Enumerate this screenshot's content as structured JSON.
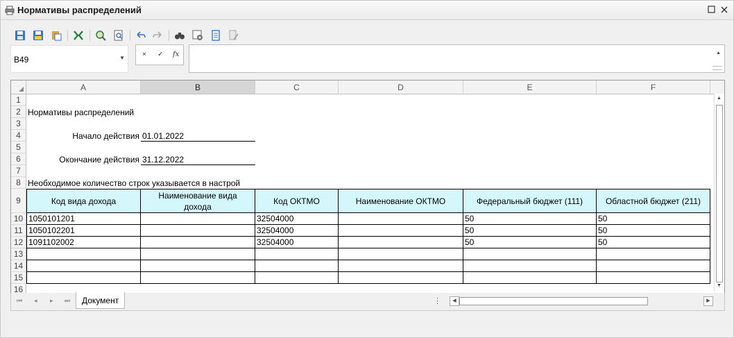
{
  "window": {
    "title": "Нормативы распределений",
    "icon": "printer-icon"
  },
  "toolbar": {
    "icons": [
      "save-icon",
      "save-as-icon",
      "paste-icon",
      "excel-export-icon",
      "find-icon",
      "preview-icon",
      "undo-icon",
      "redo-icon",
      "binoculars-icon",
      "settings-icon",
      "report-icon",
      "edit-icon"
    ]
  },
  "namebox": {
    "value": "B49"
  },
  "formula_bar": {
    "cancel": "×",
    "confirm": "✓",
    "fx": "fx",
    "value": ""
  },
  "sheet": {
    "columns": [
      "A",
      "B",
      "C",
      "D",
      "E",
      "F"
    ],
    "selected_column": "B",
    "row_numbers": [
      "1",
      "2",
      "3",
      "4",
      "5",
      "6",
      "7",
      "8",
      "9",
      "10",
      "11",
      "12",
      "13",
      "14",
      "15",
      "16"
    ],
    "report_title": "Нормативы распределений",
    "start_label": "Начало действия",
    "start_value": "01.01.2022",
    "end_label": "Окончание действия",
    "end_value": "31.12.2022",
    "note": "Необходимое количество строк указывается в настрой",
    "headers": [
      "Код вида дохода",
      "Наименование вида дохода",
      "Код ОКТМО",
      "Наименование ОКТМО",
      "Федеральный бюджет (111)",
      "Областной бюджет (211)"
    ],
    "rows": [
      [
        "1050101201",
        "",
        "32504000",
        "",
        "50",
        "50"
      ],
      [
        "1050102201",
        "",
        "32504000",
        "",
        "50",
        "50"
      ],
      [
        "1091102002",
        "",
        "32504000",
        "",
        "50",
        "50"
      ],
      [
        "",
        "",
        "",
        "",
        "",
        ""
      ],
      [
        "",
        "",
        "",
        "",
        "",
        ""
      ],
      [
        "",
        "",
        "",
        "",
        "",
        ""
      ]
    ]
  },
  "tabs": {
    "active": "Документ"
  },
  "colors": {
    "header_fill": "#d4f7fb",
    "selected_column": "#d6d6d6"
  }
}
